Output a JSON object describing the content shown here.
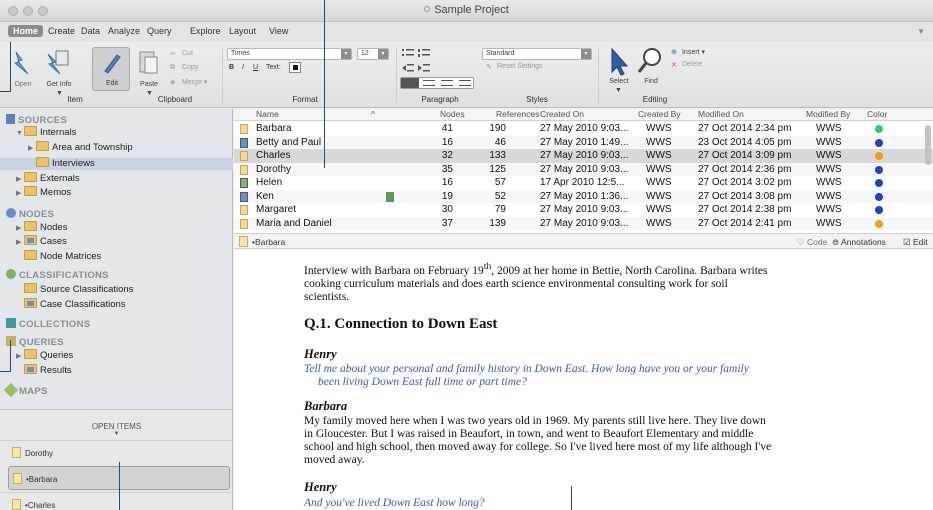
{
  "window": {
    "title": "Sample Project"
  },
  "ribbon": {
    "tabs": [
      "Home",
      "Create",
      "Data",
      "Analyze",
      "Query",
      "Explore",
      "Layout",
      "View"
    ],
    "item": {
      "open": "Open",
      "get_info": "Get Info",
      "edit": "Edit",
      "label": "Item"
    },
    "clipboard": {
      "paste": "Paste",
      "cut": "Cut",
      "copy": "Copy",
      "merge": "Merge ▾",
      "label": "Clipboard"
    },
    "format": {
      "font": "Times",
      "size": "12",
      "bold": "B",
      "italic": "I",
      "underline": "U",
      "text": "Text:",
      "label": "Format"
    },
    "paragraph": {
      "label": "Paragraph"
    },
    "styles": {
      "style": "Standard",
      "reset": "Reset Settings",
      "label": "Styles"
    },
    "editing": {
      "select": "Select",
      "find": "Find",
      "insert": "Insert ▾",
      "delete": "Delete",
      "label": "Editing"
    }
  },
  "nav": {
    "sources_head": "SOURCES",
    "internals": "Internals",
    "area": "Area and Township",
    "interviews": "Interviews",
    "externals": "Externals",
    "memos": "Memos",
    "nodes_head": "NODES",
    "nodes": "Nodes",
    "cases": "Cases",
    "node_matrices": "Node Matrices",
    "class_head": "CLASSIFICATIONS",
    "source_class": "Source Classifications",
    "case_class": "Case Classifications",
    "collections_head": "COLLECTIONS",
    "queries_head": "QUERIES",
    "queries": "Queries",
    "results": "Results",
    "maps_head": "MAPS"
  },
  "open_items": {
    "title": "OPEN ITEMS",
    "items": [
      "Dorothy",
      "•Barbara",
      "•Charles"
    ]
  },
  "table": {
    "columns": [
      "Name",
      "Nodes",
      "References",
      "Created On",
      "Created By",
      "Modified On",
      "Modified By",
      "Color"
    ],
    "rows": [
      {
        "name": "Barbara",
        "nodes": "41",
        "refs": "190",
        "created": "27 May 2010 9:03...",
        "by": "WWS",
        "modified": "27 Oct 2014 2:34 pm",
        "mby": "WWS",
        "color": "#2ecc71"
      },
      {
        "name": "Betty and Paul",
        "nodes": "16",
        "refs": "46",
        "created": "27 May 2010 1:49...",
        "by": "WWS",
        "modified": "23 Oct 2014 4:05 pm",
        "mby": "WWS",
        "color": "#1f3fd6"
      },
      {
        "name": "Charles",
        "nodes": "32",
        "refs": "133",
        "created": "27 May 2010 9:03...",
        "by": "WWS",
        "modified": "27 Oct 2014 3:09 pm",
        "mby": "WWS",
        "color": "#f39c12"
      },
      {
        "name": "Dorothy",
        "nodes": "35",
        "refs": "125",
        "created": "27 May 2010 9:03...",
        "by": "WWS",
        "modified": "27 Oct 2014 2:36 pm",
        "mby": "WWS",
        "color": "#1f3fd6"
      },
      {
        "name": "Helen",
        "nodes": "16",
        "refs": "57",
        "created": "17 Apr 2010 12:5...",
        "by": "WWS",
        "modified": "27 Oct 2014 3:02 pm",
        "mby": "WWS",
        "color": "#1f3fd6"
      },
      {
        "name": "Ken",
        "nodes": "19",
        "refs": "52",
        "created": "27 May 2010 1:36...",
        "by": "WWS",
        "modified": "27 Oct 2014 3:08 pm",
        "mby": "WWS",
        "color": "#1f3fd6"
      },
      {
        "name": "Margaret",
        "nodes": "30",
        "refs": "79",
        "created": "27 May 2010 9:03...",
        "by": "WWS",
        "modified": "27 Oct 2014 2:38 pm",
        "mby": "WWS",
        "color": "#1f3fd6"
      },
      {
        "name": "Maria and Daniel",
        "nodes": "37",
        "refs": "139",
        "created": "27 May 2010 9:03...",
        "by": "WWS",
        "modified": "27 Oct 2014 2:41 pm",
        "mby": "WWS",
        "color": "#f39c12"
      }
    ]
  },
  "detail": {
    "crumb": "•Barbara",
    "code": "Code",
    "annotations": "Annotations",
    "edit": "Edit"
  },
  "document": {
    "intro_a": "Interview with Barbara on February 19",
    "intro_sup": "th",
    "intro_b": ", 2009 at her home in Bettie, North Carolina. Barbara writes cooking curriculum materials and does earth science environmental consulting work for soil scientists.",
    "heading": "Q.1. Connection to Down East",
    "speaker1": "Henry",
    "q1_a": "Tell me about your personal and family history in Down East. How long have you or your family",
    "q1_b": "been living Down East full time or part time?",
    "speaker2": "Barbara",
    "a1": "My family moved here when I was two years old in 1969. My parents still live here. They live down in Gloucester. But I was raised in Beaufort, in town, and went to Beaufort Elementary and middle school and high school, then moved away for college. So I've lived here most of my life although I've moved away.",
    "speaker3": "Henry",
    "q2": "And you've lived Down East how long?"
  }
}
